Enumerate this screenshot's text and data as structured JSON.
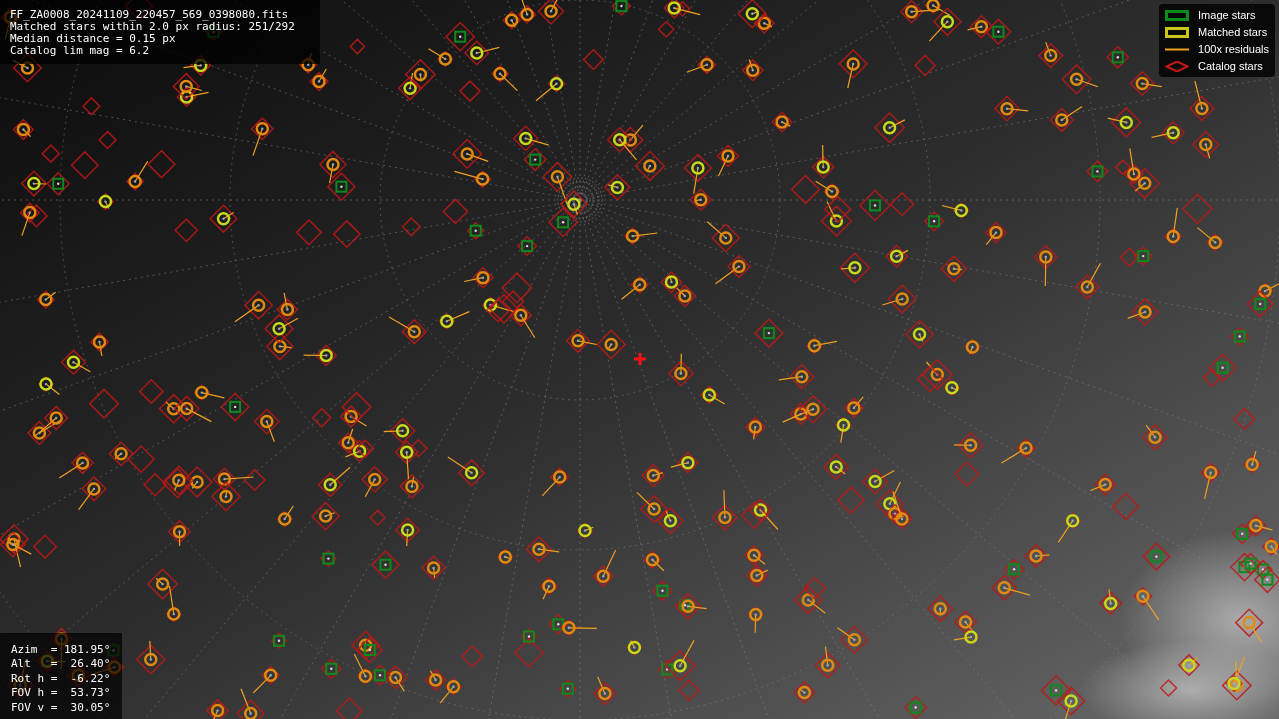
{
  "file_info": [
    "FF_ZA0008_20241109_220457_569_0398080.fits",
    "Matched stars within 2.0 px radius: 251/292",
    "Median distance = 0.15 px",
    "Catalog lim mag = 6.2"
  ],
  "legend": [
    {
      "label": "Image stars",
      "kind": "image"
    },
    {
      "label": "Matched stars",
      "kind": "matched"
    },
    {
      "label": "100x residuals",
      "kind": "residual"
    },
    {
      "label": "Catalog stars",
      "kind": "catalog"
    }
  ],
  "pointing": [
    "Azim  = 181.95°",
    "Alt   =  26.40°",
    "Rot h =  -6.22°",
    "FOV h =  53.73°",
    "FOV v =  30.05°"
  ]
}
